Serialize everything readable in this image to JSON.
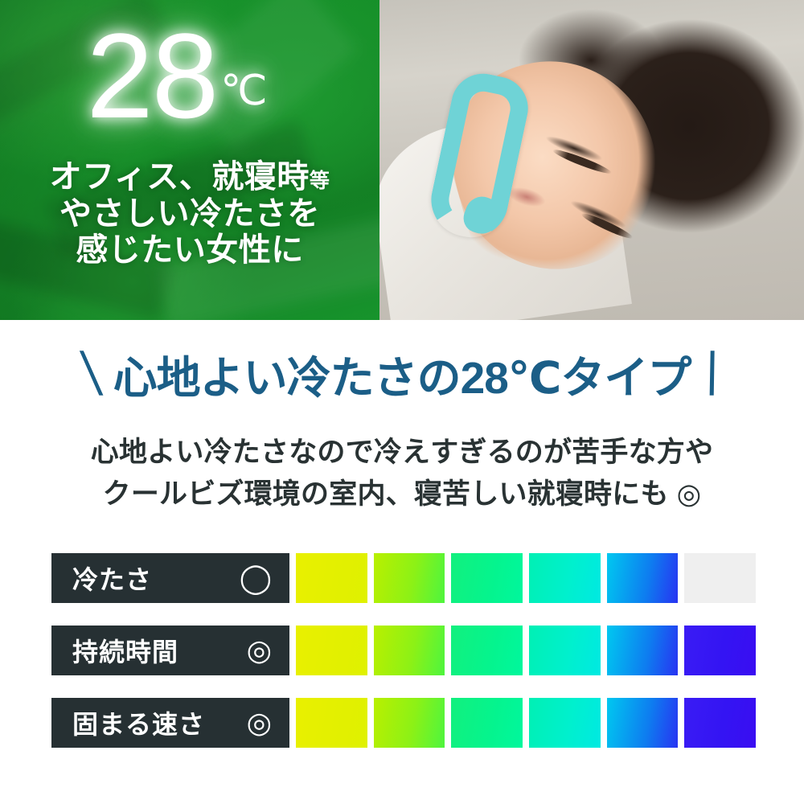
{
  "hero": {
    "temperature": "28",
    "temperature_unit": "℃",
    "lines": [
      "オフィス、就寝時",
      "やさしい冷たさを",
      "感じたい女性に"
    ],
    "line1_small_suffix": "等",
    "photo_alt": "neck-cooling-ring-sleeping-woman",
    "green_panel_color": "#169029",
    "text_color": "#ffffff"
  },
  "headline": {
    "left_slash": "\\",
    "right_slash": "/",
    "text": "心地よい冷たさの28℃タイプ",
    "color": "#1B5E87"
  },
  "lead": {
    "line1": "心地よい冷たさなので冷えすぎるのが苦手な方や",
    "line2": "クールビズ環境の室内、寝苦しい就寝時にも ◎",
    "color": "#293233"
  },
  "ratings": {
    "label_bg": "#263033",
    "label_text_color": "#ffffff",
    "empty_cell_color": "#efefef",
    "rows": [
      {
        "label": "冷たさ",
        "mark": "◯",
        "mark_name": "circle-single",
        "filled": 5,
        "total": 6,
        "cells": [
          "#e3f000",
          "#8cf116",
          "#05f48d",
          "#00f0cd",
          "#0e7cf0",
          "#efefef"
        ]
      },
      {
        "label": "持続時間",
        "mark": "◎",
        "mark_name": "circle-double",
        "filled": 6,
        "total": 6,
        "cells": [
          "#e3f000",
          "#8cf116",
          "#05f48d",
          "#00f0cd",
          "#0e7cf0",
          "#3414f3"
        ]
      },
      {
        "label": "固まる速さ",
        "mark": "◎",
        "mark_name": "circle-double",
        "filled": 6,
        "total": 6,
        "cells": [
          "#e3f000",
          "#8cf116",
          "#05f48d",
          "#00f0cd",
          "#0e7cf0",
          "#3414f3"
        ]
      }
    ]
  }
}
